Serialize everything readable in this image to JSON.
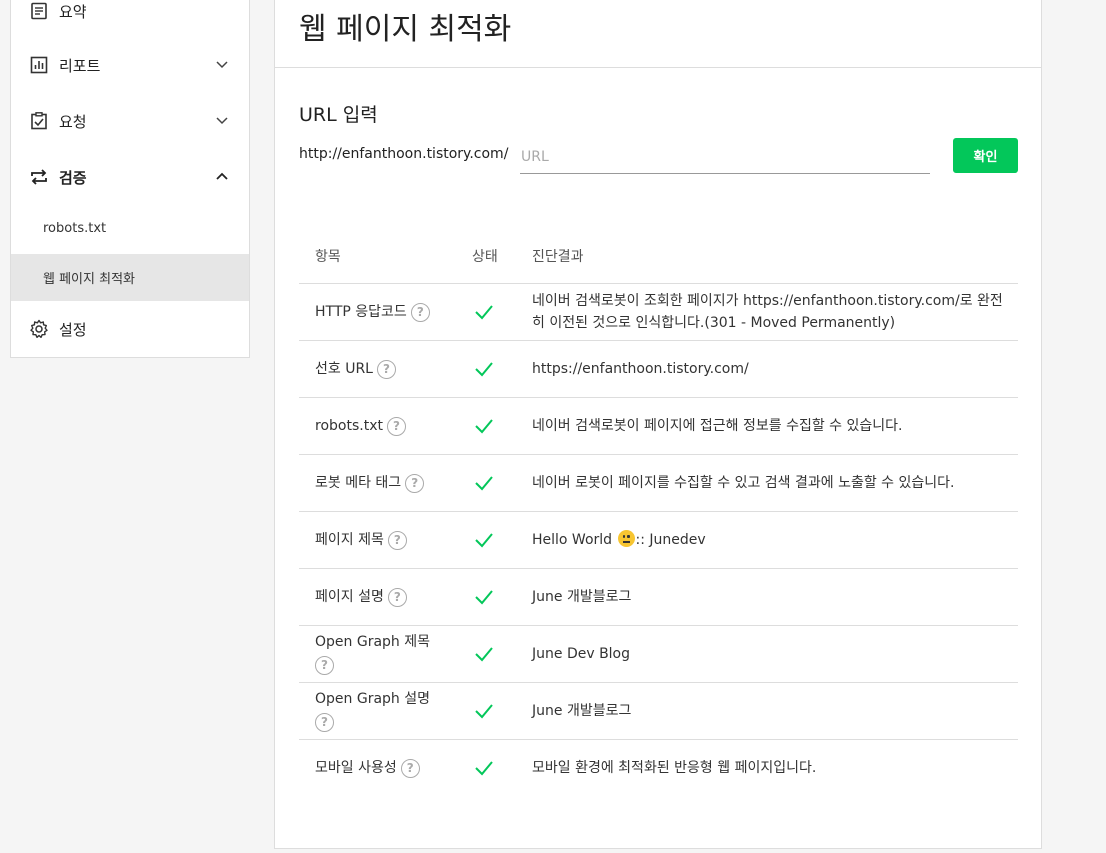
{
  "sidebar": {
    "items": [
      {
        "label": "요약",
        "icon": "document-icon"
      },
      {
        "label": "리포트",
        "icon": "bar-chart-icon"
      },
      {
        "label": "요청",
        "icon": "clipboard-check-icon"
      },
      {
        "label": "검증",
        "icon": "swap-arrows-icon"
      },
      {
        "label": "설정",
        "icon": "gear-icon"
      }
    ],
    "subitems": [
      {
        "label": "robots.txt"
      },
      {
        "label": "웹 페이지 최적화"
      }
    ]
  },
  "main": {
    "title": "웹 페이지 최적화",
    "url_section_label": "URL 입력",
    "url_prefix": "http://enfanthoon.tistory.com/",
    "url_placeholder": "URL",
    "url_value": "",
    "confirm_label": "확인",
    "table": {
      "headers": [
        "항목",
        "상태",
        "진단결과"
      ],
      "rows": [
        {
          "item": "HTTP 응답코드",
          "status": "ok",
          "result": "네이버 검색로봇이 조회한 페이지가 https://enfanthoon.tistory.com/로 완전히 이전된 것으로 인식합니다.(301 - Moved Permanently)"
        },
        {
          "item": "선호 URL",
          "status": "ok",
          "result": "https://enfanthoon.tistory.com/"
        },
        {
          "item": "robots.txt",
          "status": "ok",
          "result": "네이버 검색로봇이 페이지에 접근해 정보를 수집할 수 있습니다."
        },
        {
          "item": "로봇 메타 태그",
          "status": "ok",
          "result": "네이버 로봇이 페이지를 수집할 수 있고 검색 결과에 노출할 수 있습니다."
        },
        {
          "item": "페이지 제목",
          "status": "ok",
          "result_before": "Hello World ",
          "result_after": ":: Junedev"
        },
        {
          "item": "페이지 설명",
          "status": "ok",
          "result": "June 개발블로그"
        },
        {
          "item": "Open Graph 제목",
          "status": "ok",
          "result": "June Dev Blog"
        },
        {
          "item": "Open Graph 설명",
          "status": "ok",
          "result": "June 개발블로그"
        },
        {
          "item": "모바일 사용성",
          "status": "ok",
          "result": "모바일 환경에 최적화된 반응형 웹 페이지입니다."
        }
      ]
    }
  },
  "colors": {
    "accent": "#03c75a",
    "check": "#03c75a"
  }
}
